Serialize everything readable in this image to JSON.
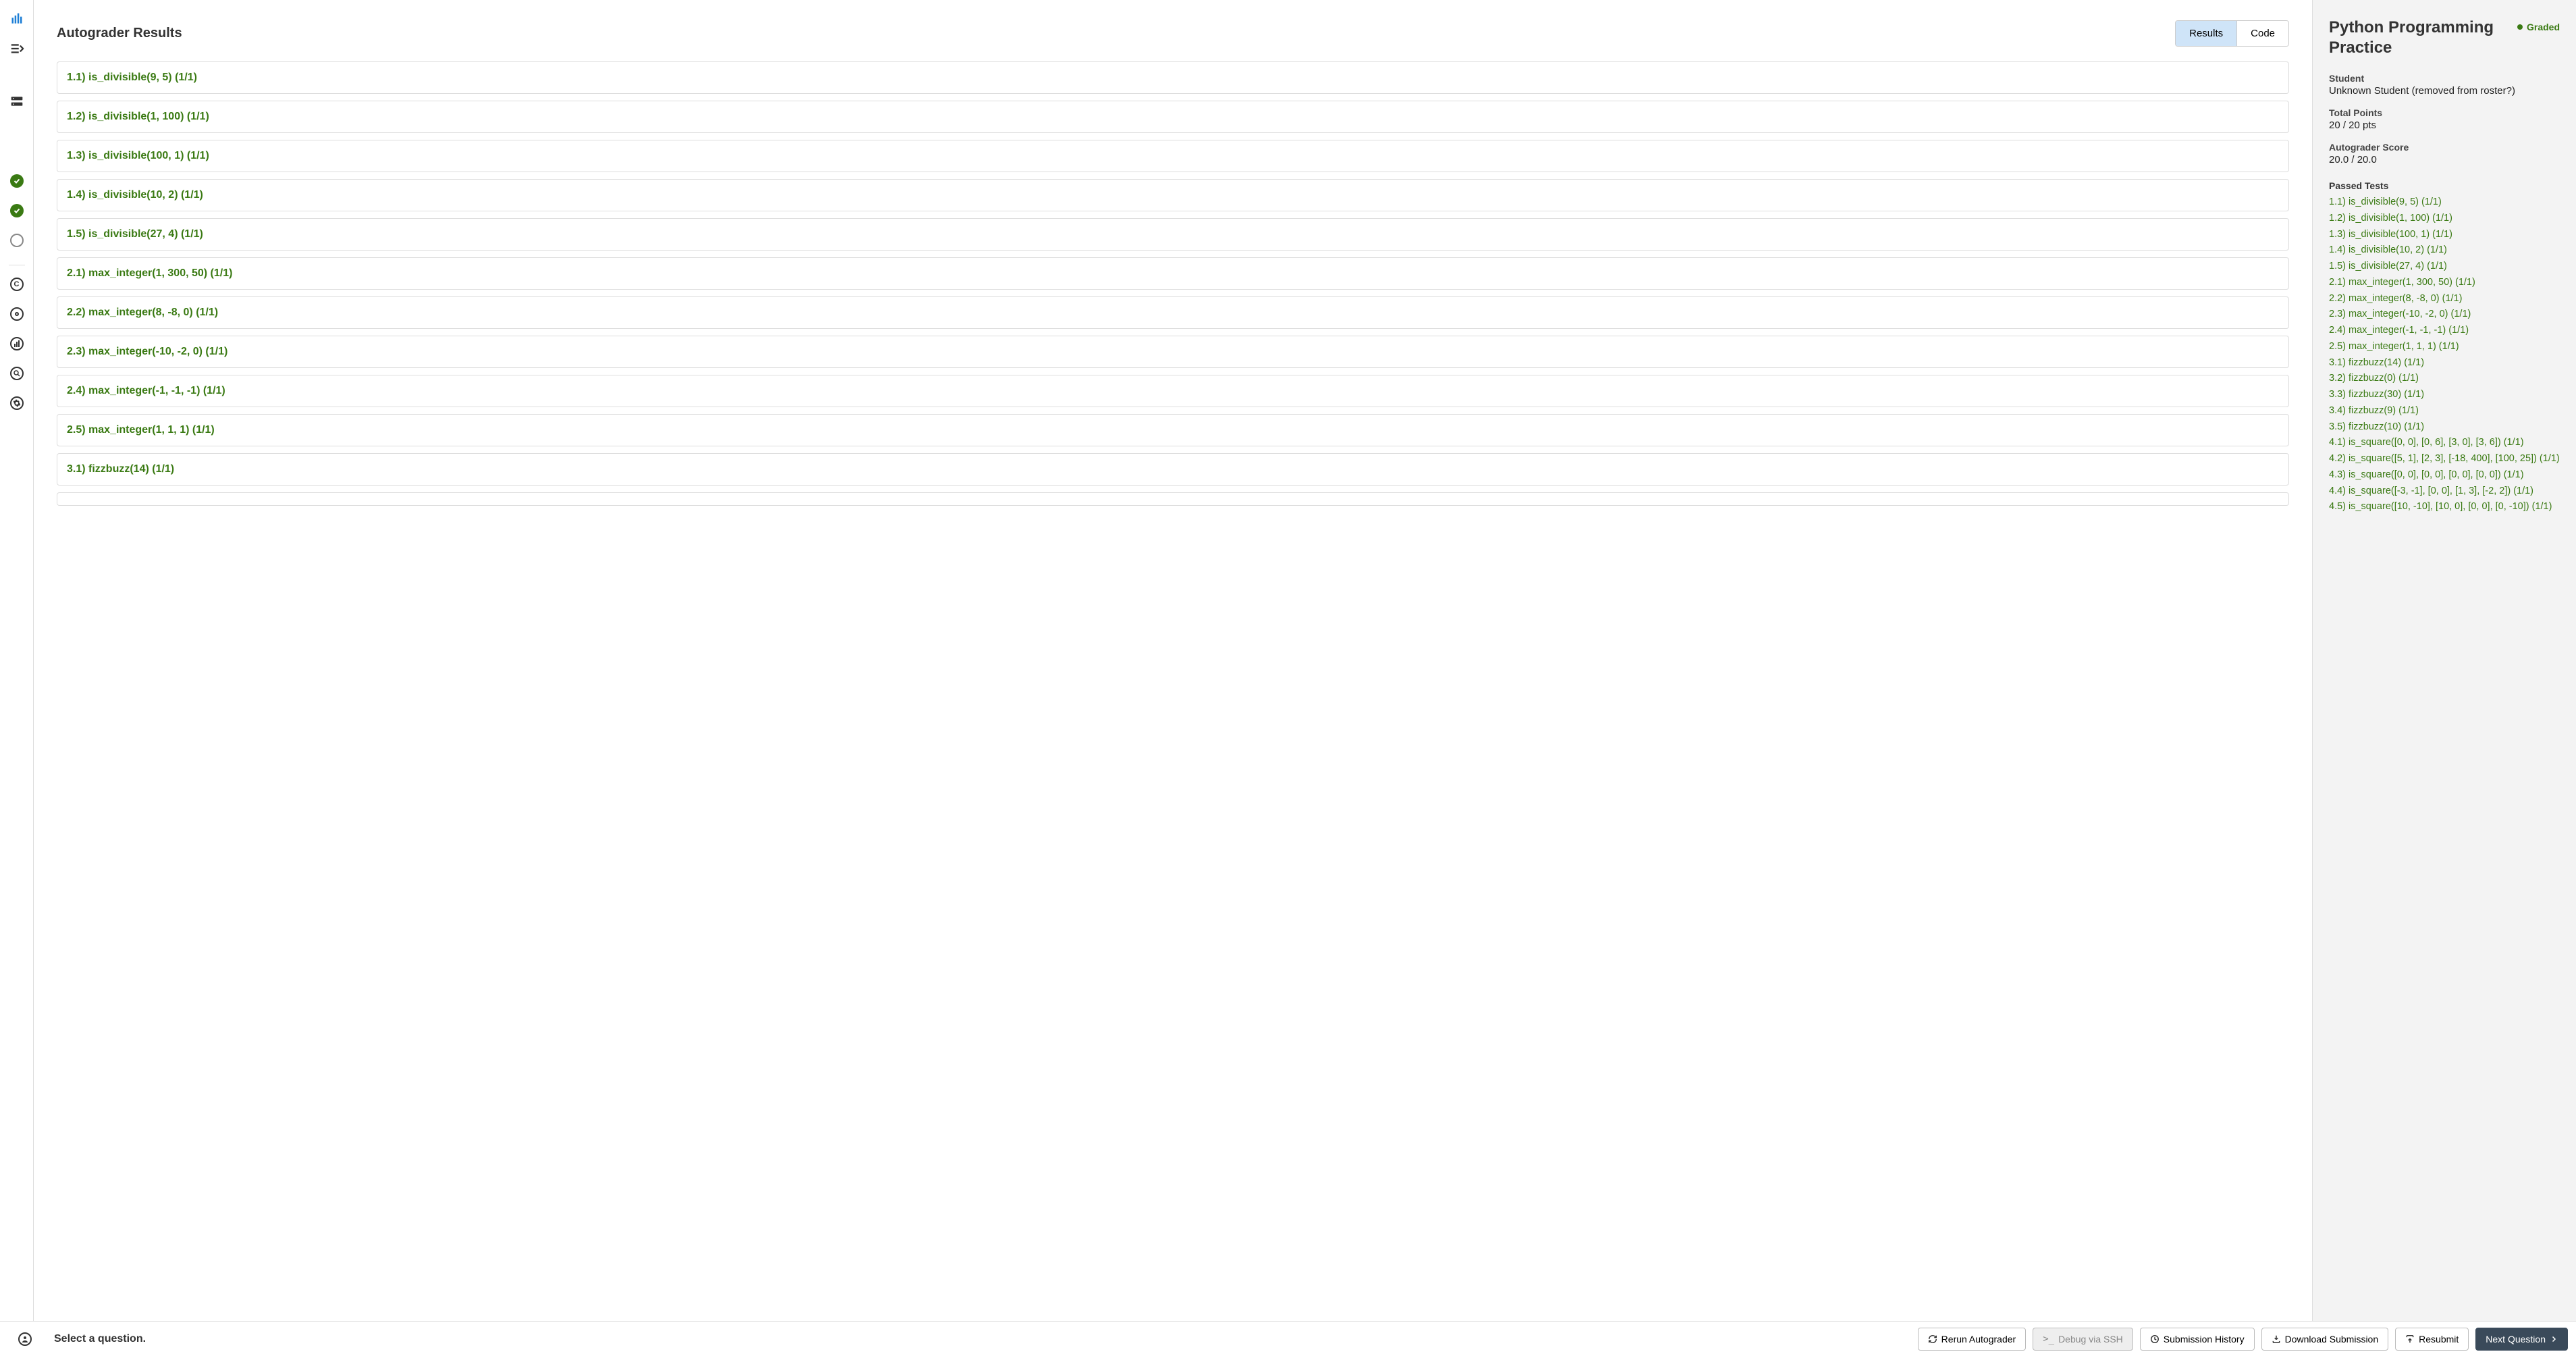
{
  "header": {
    "title": "Autograder Results",
    "tabs": {
      "results": "Results",
      "code": "Code"
    }
  },
  "tests": [
    "1.1) is_divisible(9, 5) (1/1)",
    "1.2) is_divisible(1, 100) (1/1)",
    "1.3) is_divisible(100, 1) (1/1)",
    "1.4) is_divisible(10, 2) (1/1)",
    "1.5) is_divisible(27, 4) (1/1)",
    "2.1) max_integer(1, 300, 50) (1/1)",
    "2.2) max_integer(8, -8, 0) (1/1)",
    "2.3) max_integer(-10, -2, 0) (1/1)",
    "2.4) max_integer(-1, -1, -1) (1/1)",
    "2.5) max_integer(1, 1, 1) (1/1)",
    "3.1) fizzbuzz(14) (1/1)"
  ],
  "right": {
    "assignment_title": "Python Programming Practice",
    "status": "Graded",
    "student_label": "Student",
    "student_value": "Unknown Student (removed from roster?)",
    "points_label": "Total Points",
    "points_value": "20 / 20 pts",
    "ag_label": "Autograder Score",
    "ag_value": "20.0 / 20.0",
    "passed_label": "Passed Tests",
    "passed": [
      "1.1) is_divisible(9, 5) (1/1)",
      "1.2) is_divisible(1, 100) (1/1)",
      "1.3) is_divisible(100, 1) (1/1)",
      "1.4) is_divisible(10, 2) (1/1)",
      "1.5) is_divisible(27, 4) (1/1)",
      "2.1) max_integer(1, 300, 50) (1/1)",
      "2.2) max_integer(8, -8, 0) (1/1)",
      "2.3) max_integer(-10, -2, 0) (1/1)",
      "2.4) max_integer(-1, -1, -1) (1/1)",
      "2.5) max_integer(1, 1, 1) (1/1)",
      "3.1) fizzbuzz(14) (1/1)",
      "3.2) fizzbuzz(0) (1/1)",
      "3.3) fizzbuzz(30) (1/1)",
      "3.4) fizzbuzz(9) (1/1)",
      "3.5) fizzbuzz(10) (1/1)",
      "4.1) is_square([0, 0], [0, 6], [3, 0], [3, 6]) (1/1)",
      "4.2) is_square([5, 1], [2, 3], [-18, 400], [100, 25]) (1/1)",
      "4.3) is_square([0, 0], [0, 0], [0, 0], [0, 0]) (1/1)",
      "4.4) is_square([-3, -1], [0, 0], [1, 3], [-2, 2]) (1/1)",
      "4.5) is_square([10, -10], [10, 0], [0, 0], [0, -10]) (1/1)"
    ]
  },
  "footer": {
    "select_text": "Select a question.",
    "rerun": "Rerun Autograder",
    "debug": "Debug via SSH",
    "history": "Submission History",
    "download": "Download Submission",
    "resubmit": "Resubmit",
    "next": "Next Question"
  }
}
